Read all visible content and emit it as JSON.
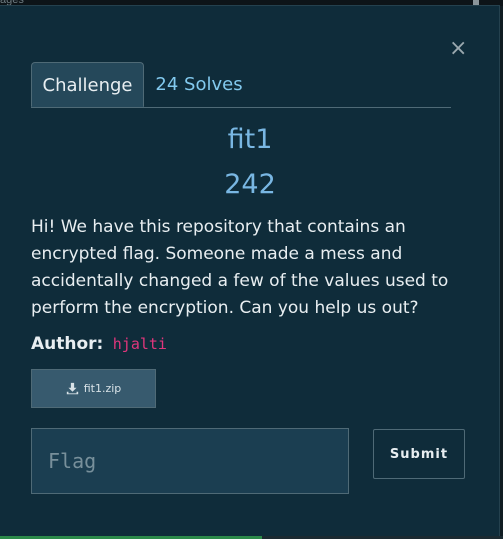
{
  "backdrop": {
    "text": "ages"
  },
  "modal": {
    "close_label": "×",
    "tabs": [
      {
        "label": "Challenge",
        "active": true
      },
      {
        "label": "24 Solves",
        "active": false
      }
    ],
    "challenge": {
      "name": "fit1",
      "points": "242",
      "description": "Hi! We have this repository that contains an encrypted flag. Someone made a mess and accidentally changed a few of the values used to perform the encryption. Can you help us out?",
      "author_label": "Author:",
      "author_name": "hjalti",
      "file": {
        "name": "fit1.zip",
        "icon": "download-icon"
      }
    },
    "flag_input": {
      "placeholder": "Flag",
      "value": ""
    },
    "submit_label": "Submit"
  },
  "colors": {
    "modal_bg": "#0f2c3a",
    "accent": "#79b7e3",
    "author": "#e0367c",
    "progress": "#2c8a4a"
  },
  "progress": {
    "fraction": 0.52
  }
}
